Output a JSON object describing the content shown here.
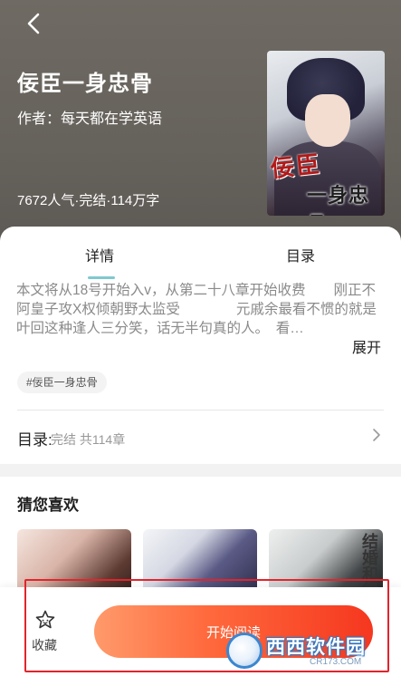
{
  "book": {
    "title": "佞臣一身忠骨",
    "author": "作者：每天都在学英语",
    "stats": "7672人气·完结·114万字",
    "cover_title_line1": "佞臣",
    "cover_title_line2": "一身忠骨"
  },
  "tabs": [
    {
      "label": "详情"
    },
    {
      "label": "目录"
    }
  ],
  "description": {
    "text": "本文将从18号开始入v，从第二十八章开始收费　　刚正不阿皇子攻X权倾朝野太监受　　　　元戚余最看不惯的就是叶回这种逢人三分笑，话无半句真的人。　看…",
    "expand_label": "展开"
  },
  "tag": "#佞臣一身忠骨",
  "toc": {
    "label": "目录:",
    "status": "完结 共114章"
  },
  "recommend": {
    "title": "猜您喜欢",
    "thumb3_text": "结婚和律"
  },
  "bottom": {
    "favorite_label": "收藏",
    "read_label": "开始阅读"
  },
  "watermark": {
    "text": "西西软件园",
    "sub": "CR173.COM"
  },
  "colors": {
    "accent_tab": "#7fc9cf",
    "read_button": "#f5371f",
    "highlight_box": "#e2242c"
  },
  "icons": {
    "back": "chevron-left-icon",
    "favorite": "star-outline-icon",
    "toc_more": "chevron-right-icon"
  }
}
